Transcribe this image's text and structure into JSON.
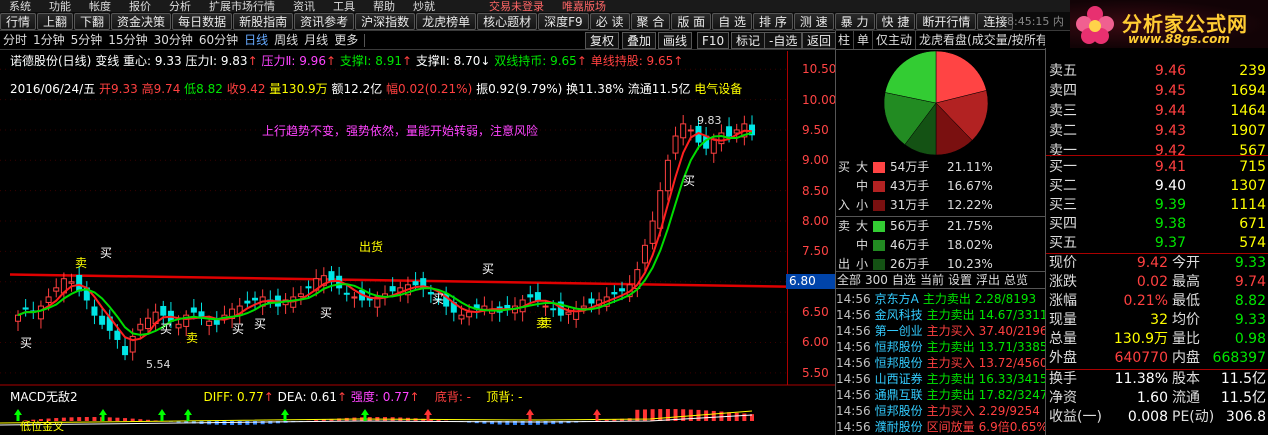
{
  "menubar": [
    "系统",
    "功能",
    "帐度",
    "报价",
    "分析",
    "扩展市场行情",
    "资讯",
    "工具",
    "帮助",
    "炒就",
    "",
    "",
    "交易未登录",
    "唯嘉版场"
  ],
  "toolbar": [
    "行情",
    "上翻",
    "下翻",
    "资金决策",
    "每日数据",
    "新股指南",
    "资讯参考",
    "沪深指数",
    "龙虎榜单",
    "核心题材",
    "深度F9",
    "必 读",
    "聚 合",
    "版 面",
    "自 选",
    "排 序",
    "测 速",
    "暴 力",
    "快 捷",
    "断开行情",
    "连接"
  ],
  "clock": "18:45:15 内地",
  "logo": {
    "brand": "分析家公式网",
    "url": "www.88gs.com"
  },
  "periods": [
    "分时",
    "1分钟",
    "5分钟",
    "15分钟",
    "30分钟",
    "60分钟",
    "日线",
    "周线",
    "月线",
    "更多"
  ],
  "period_active": "日线",
  "chart_buttons": [
    "复权",
    "叠加",
    "画线",
    "F10",
    "标记",
    "-自选",
    "返回"
  ],
  "info1": {
    "name": "诺德股份(日线)",
    "bianxian": "变线",
    "center": "重心: 9.33",
    "press1": "压力Ⅰ: 9.83",
    "press2": "压力Ⅱ: 9.96",
    "support1": "支撑Ⅰ: 8.91",
    "support2": "支撑Ⅱ: 8.70",
    "line_hold": "双线持币: 9.65",
    "single_hold": "单线持股: 9.65"
  },
  "info2": {
    "date": "2016/06/24/五",
    "open": "开9.33",
    "high": "高9.74",
    "low": "低8.82",
    "close": "收9.42",
    "vol": "量130.9万",
    "amount": "额12.2亿",
    "change": "幅0.02(0.21%)",
    "amp": "振0.92(9.79%)",
    "turn": "换11.38%",
    "float": "流通11.5亿",
    "sector": "电气设备"
  },
  "warning": "上行趋势不变，强势依然，量能开始转弱，注意风险",
  "chart_data": {
    "type": "candlestick",
    "price_ticks": [
      "10.50",
      "10.00",
      "9.50",
      "9.00",
      "8.50",
      "8.00",
      "7.50",
      "7.00",
      "6.50",
      "6.00",
      "5.50"
    ],
    "ylim": [
      5.3,
      10.8
    ],
    "current_price_label": "6.80",
    "peak_label": "9.83",
    "trough_label": "5.54",
    "signals": [
      "买",
      "卖",
      "买",
      "买",
      "卖",
      "买",
      "买",
      "买",
      "买",
      "卖",
      "卖",
      "出货",
      "买",
      "买"
    ],
    "macd": {
      "title": "MACD无敌2",
      "diff": "DIFF: 0.77",
      "dea": "DEA: 0.61",
      "strength": "强度: 0.77",
      "bottom": "底背: -",
      "top": "顶背: -",
      "note": "低位金叉"
    }
  },
  "midtabs": [
    "柱",
    "单",
    "仅主动",
    "龙虎看盘(成交量/按所有)"
  ],
  "flow": [
    {
      "side": "买",
      "size": "大",
      "color": "#ff4444",
      "vol": "54万手",
      "pct": "21.11%"
    },
    {
      "side": "",
      "size": "中",
      "color": "#b22222",
      "vol": "43万手",
      "pct": "16.67%"
    },
    {
      "side": "入",
      "size": "小",
      "color": "#7a1010",
      "vol": "31万手",
      "pct": "12.22%"
    },
    {
      "side": "卖",
      "size": "大",
      "color": "#33cc33",
      "vol": "56万手",
      "pct": "21.75%"
    },
    {
      "side": "",
      "size": "中",
      "color": "#228b22",
      "vol": "46万手",
      "pct": "18.02%"
    },
    {
      "side": "出",
      "size": "小",
      "color": "#145214",
      "vol": "26万手",
      "pct": "10.23%"
    }
  ],
  "midmenu": [
    "全部",
    "300",
    "自选",
    "当前",
    "设置",
    "浮出",
    "总览"
  ],
  "ticks": [
    {
      "t": "14:56",
      "n": "京东方A",
      "a": "主力卖出",
      "v": "2.28/8193",
      "c": "green"
    },
    {
      "t": "14:56",
      "n": "金风科技",
      "a": "主力卖出",
      "v": "14.67/3311",
      "c": "green"
    },
    {
      "t": "14:56",
      "n": "第一创业",
      "a": "主力买入",
      "v": "37.40/2196",
      "c": "red"
    },
    {
      "t": "14:56",
      "n": "恒邦股份",
      "a": "主力卖出",
      "v": "13.71/3385",
      "c": "green"
    },
    {
      "t": "14:56",
      "n": "恒邦股份",
      "a": "主力买入",
      "v": "13.72/4560",
      "c": "red"
    },
    {
      "t": "14:56",
      "n": "山西证券",
      "a": "主力卖出",
      "v": "16.33/3415",
      "c": "green"
    },
    {
      "t": "14:56",
      "n": "通鼎互联",
      "a": "主力卖出",
      "v": "17.82/3247",
      "c": "green"
    },
    {
      "t": "14:56",
      "n": "恒邦股份",
      "a": "主力买入",
      "v": "2.29/9254",
      "c": "red"
    },
    {
      "t": "14:56",
      "n": "濮耐股份",
      "a": "区间放量",
      "v": "6.9倍0.65%",
      "c": "red"
    }
  ],
  "asks": [
    {
      "l": "卖五",
      "p": "9.46",
      "v": "239"
    },
    {
      "l": "卖四",
      "p": "9.45",
      "v": "1694"
    },
    {
      "l": "卖三",
      "p": "9.44",
      "v": "1464"
    },
    {
      "l": "卖二",
      "p": "9.43",
      "v": "1907"
    },
    {
      "l": "卖一",
      "p": "9.42",
      "v": "567"
    }
  ],
  "bids": [
    {
      "l": "买一",
      "p": "9.41",
      "v": "715"
    },
    {
      "l": "买二",
      "p": "9.40",
      "v": "1307"
    },
    {
      "l": "买三",
      "p": "9.39",
      "v": "1114"
    },
    {
      "l": "买四",
      "p": "9.38",
      "v": "671"
    },
    {
      "l": "买五",
      "p": "9.37",
      "v": "574"
    }
  ],
  "stats": [
    {
      "l1": "现价",
      "v1": "9.42",
      "c1": "red",
      "l2": "今开",
      "v2": "9.33",
      "c2": "green"
    },
    {
      "l1": "涨跌",
      "v1": "0.02",
      "c1": "red",
      "l2": "最高",
      "v2": "9.74",
      "c2": "red"
    },
    {
      "l1": "涨幅",
      "v1": "0.21%",
      "c1": "red",
      "l2": "最低",
      "v2": "8.82",
      "c2": "green"
    },
    {
      "l1": "现量",
      "v1": "32",
      "c1": "yellow",
      "l2": "均价",
      "v2": "9.33",
      "c2": "green"
    },
    {
      "l1": "总量",
      "v1": "130.9万",
      "c1": "yellow",
      "l2": "量比",
      "v2": "0.98",
      "c2": "green"
    },
    {
      "l1": "外盘",
      "v1": "640770",
      "c1": "red",
      "l2": "内盘",
      "v2": "668397",
      "c2": "green"
    }
  ],
  "stats2": [
    {
      "l1": "换手",
      "v1": "11.38%",
      "c1": "white",
      "l2": "股本",
      "v2": "11.5亿",
      "c2": "white"
    },
    {
      "l1": "净资",
      "v1": "1.60",
      "c1": "white",
      "l2": "流通",
      "v2": "11.5亿",
      "c2": "white"
    },
    {
      "l1": "收益(一)",
      "v1": "0.008",
      "c1": "white",
      "l2": "PE(动)",
      "v2": "306.8",
      "c2": "white"
    }
  ],
  "colors": {
    "up": "#ff4040",
    "down": "#00e6e6",
    "support_line": "#e00000",
    "ma_red": "#ff2020",
    "ma_green": "#00dd00"
  }
}
